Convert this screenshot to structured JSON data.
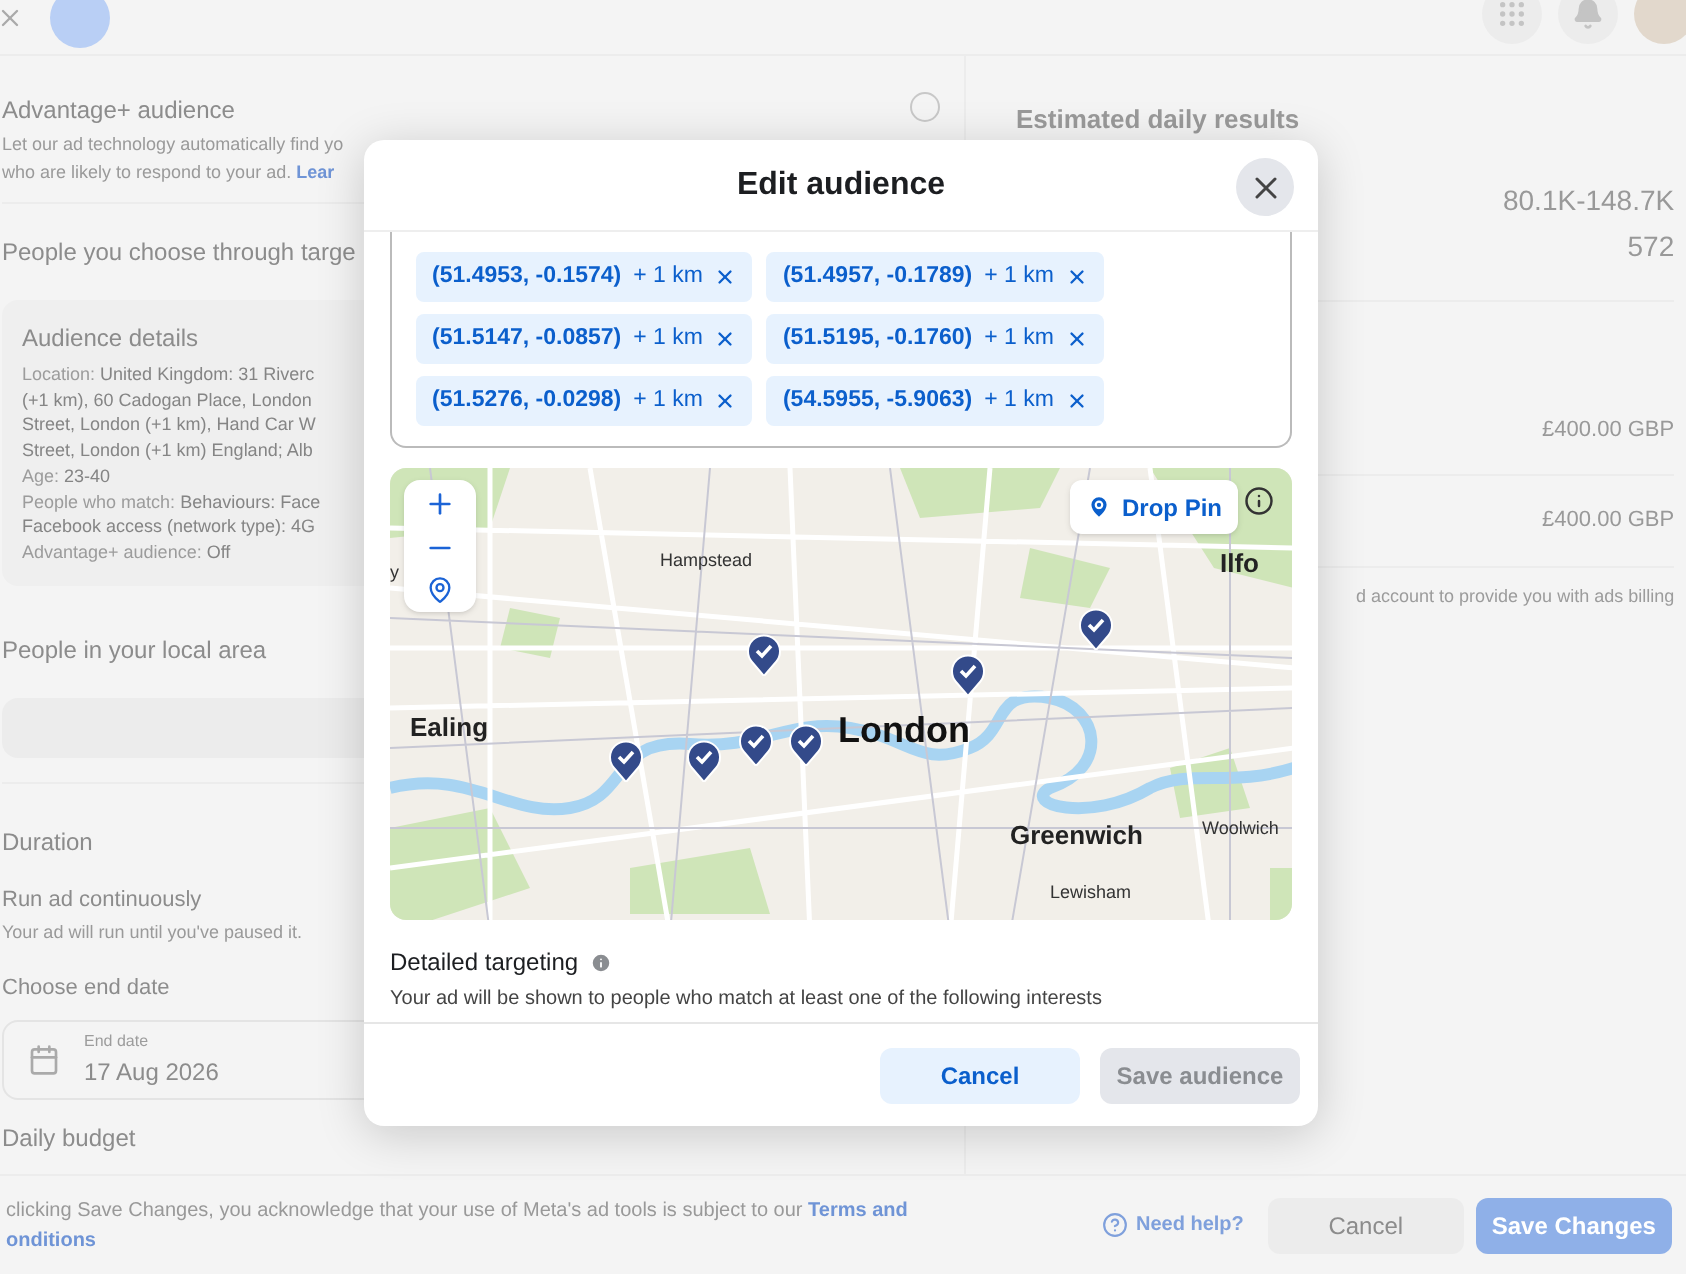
{
  "page": {
    "advantage": {
      "title": "Advantage+ audience",
      "selected": false,
      "description": "Let our ad technology automatically find yo",
      "description_2": "who are likely to respond to your ad.",
      "link": "Lear"
    },
    "targeting_heading": "People you choose through targe",
    "audience_details": {
      "title": "Audience details",
      "lines": [
        {
          "label": "Location:",
          "value": "United Kingdom: 31 Riverc"
        },
        {
          "value": "(+1 km), 60 Cadogan Place, London"
        },
        {
          "value": "Street, London (+1 km), Hand Car W"
        },
        {
          "value": "Street, London (+1 km) England; Alb"
        },
        {
          "label": "Age:",
          "value": "23-40"
        },
        {
          "label": "People who match:",
          "value": "Behaviours: Face"
        },
        {
          "value": "Facebook access (network type): 4G"
        },
        {
          "label": "Advantage+ audience:",
          "value": "Off"
        }
      ]
    },
    "local_area_heading": "People in your local area",
    "duration": {
      "title": "Duration",
      "option": "Run ad continuously",
      "option_description": "Your ad will run until you've paused it.",
      "end_date_label": "Choose end date",
      "end_date_field_label": "End date",
      "end_date": "17 Aug 2026"
    },
    "budget_heading": "Daily budget",
    "results": {
      "title": "Estimated daily results",
      "range": "80.1K-148.7K",
      "count": "572",
      "amounts": [
        "£400.00 GBP",
        "£400.00 GBP"
      ],
      "billing_note": "d account to provide you with ads billing"
    },
    "footer": {
      "notice": "clicking Save Changes, you acknowledge that your use of Meta's ad tools is subject to our",
      "terms_link": "Terms and",
      "terms_link_2": "onditions",
      "help": "Need help?",
      "cancel": "Cancel",
      "save": "Save Changes"
    }
  },
  "dialog": {
    "title": "Edit audience",
    "locations": [
      {
        "coords": "(51.4953, -0.1574)",
        "radius": "+ 1 km"
      },
      {
        "coords": "(51.4957, -0.1789)",
        "radius": "+ 1 km"
      },
      {
        "coords": "(51.5147, -0.0857)",
        "radius": "+ 1 km"
      },
      {
        "coords": "(51.5195, -0.1760)",
        "radius": "+ 1 km"
      },
      {
        "coords": "(51.5276, -0.0298)",
        "radius": "+ 1 km"
      },
      {
        "coords": "(54.5955, -5.9063)",
        "radius": "+ 1 km"
      }
    ],
    "map": {
      "drop_pin": "Drop Pin",
      "labels": [
        {
          "text": "y",
          "kind": "place"
        },
        {
          "text": "Hampstead",
          "kind": "place"
        },
        {
          "text": "Ilfo",
          "kind": "town"
        },
        {
          "text": "Ealing",
          "kind": "town"
        },
        {
          "text": "London",
          "kind": "city"
        },
        {
          "text": "Greenwich",
          "kind": "town"
        },
        {
          "text": "Woolwich",
          "kind": "place"
        },
        {
          "text": "Lewisham",
          "kind": "place"
        }
      ]
    },
    "detailed_targeting": {
      "title": "Detailed targeting",
      "description": "Your ad will be shown to people who match at least one of the following interests"
    },
    "cancel": "Cancel",
    "save": {
      "label": "Save audience",
      "disabled": true
    }
  }
}
